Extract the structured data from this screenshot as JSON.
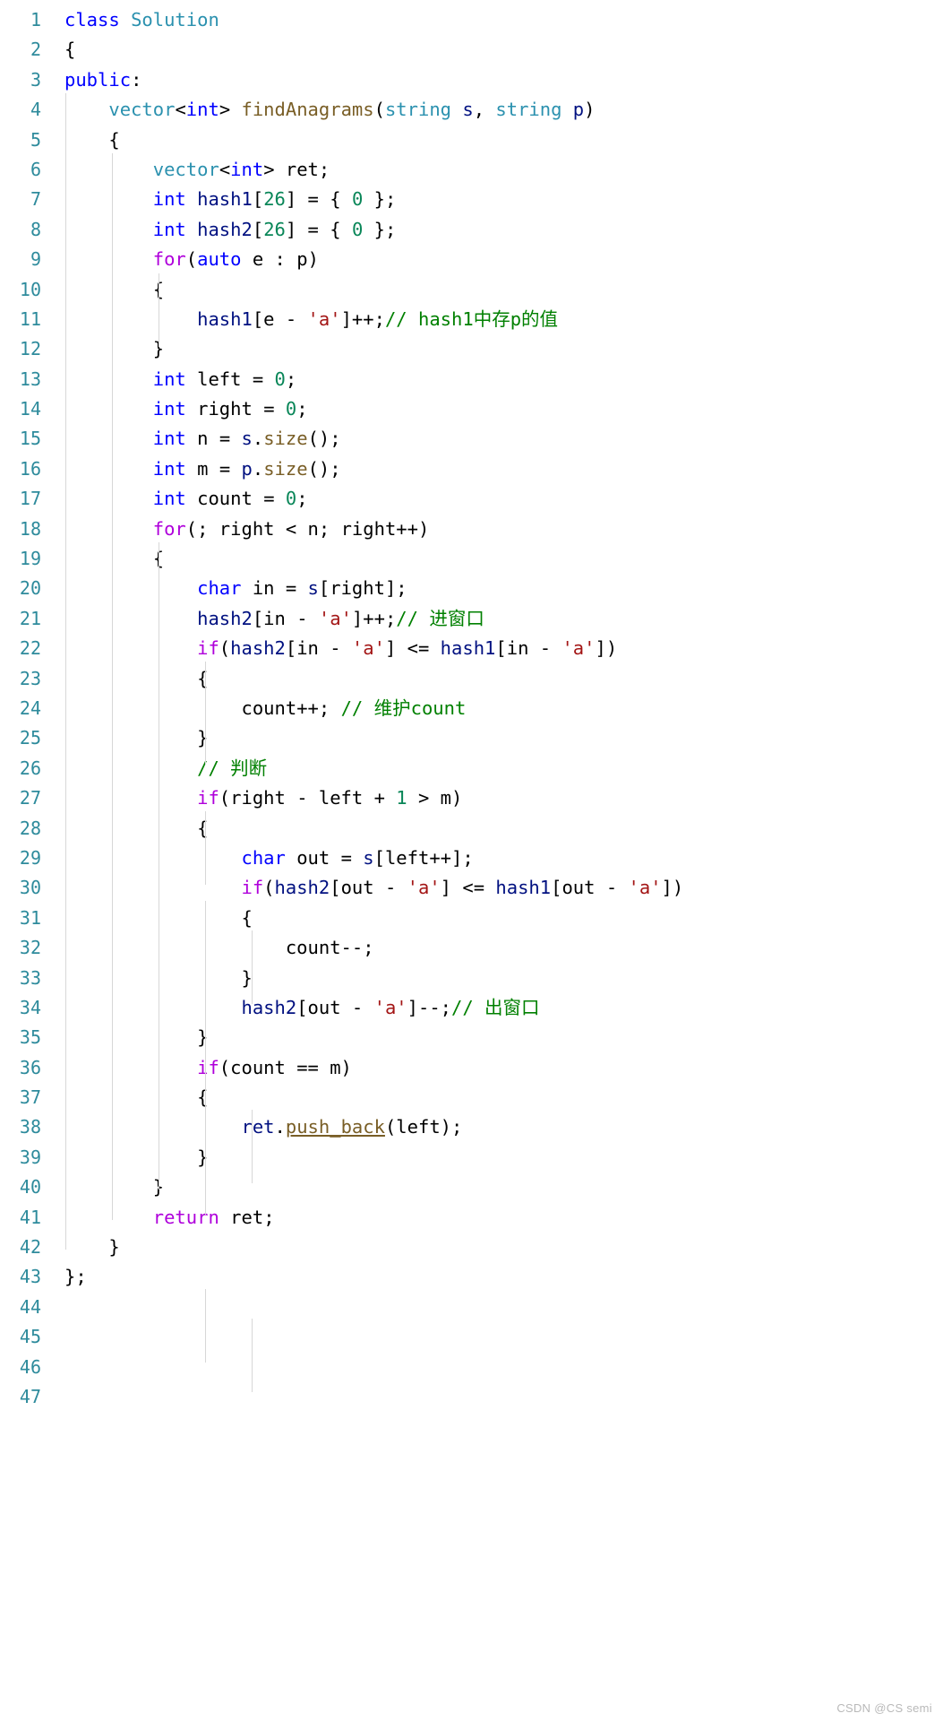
{
  "editor": {
    "language": "cpp",
    "first_line": 1,
    "last_line": 47,
    "colors": {
      "background": "#ffffff",
      "line_number": "#2e8b9c",
      "keyword": "#0000ff",
      "control_keyword": "#af00db",
      "type": "#2b91af",
      "function": "#795e26",
      "variable": "#001080",
      "number": "#098658",
      "string": "#a31515",
      "comment": "#008000",
      "indent_guide": "#d7d7d7",
      "watermark": "#b9b9b9"
    }
  },
  "line_numbers": [
    "1",
    "2",
    "3",
    "4",
    "5",
    "6",
    "7",
    "8",
    "9",
    "10",
    "11",
    "12",
    "13",
    "14",
    "15",
    "16",
    "17",
    "18",
    "19",
    "20",
    "21",
    "22",
    "23",
    "24",
    "25",
    "26",
    "27",
    "28",
    "29",
    "30",
    "31",
    "32",
    "33",
    "34",
    "35",
    "36",
    "37",
    "38",
    "39",
    "40",
    "41",
    "42",
    "43",
    "44",
    "45",
    "46",
    "47"
  ],
  "code_lines": [
    "class Solution",
    "{",
    "public:",
    "    vector<int> findAnagrams(string s, string p)",
    "    {",
    "        vector<int> ret;",
    "        int hash1[26] = { 0 };",
    "        int hash2[26] = { 0 };",
    "        for(auto e : p)",
    "        {",
    "            hash1[e - 'a']++;// hash1中存p的值",
    "        }",
    "        int left = 0;",
    "        int right = 0;",
    "        int n = s.size();",
    "        int m = p.size();",
    "        int count = 0;",
    "        for(; right < n; right++)",
    "        {",
    "            char in = s[right];",
    "            hash2[in - 'a']++;// 进窗口",
    "            if(hash2[in - 'a'] <= hash1[in - 'a'])",
    "            {",
    "                count++; // 维护count",
    "            }",
    "            // 判断",
    "            if(right - left + 1 > m)",
    "            {",
    "                char out = s[left++];",
    "                if(hash2[out - 'a'] <= hash1[out - 'a'])",
    "                {",
    "                    count--;",
    "                }",
    "                hash2[out - 'a']--;// 出窗口",
    "            }",
    "            if(count == m)",
    "            {",
    "                ret.push_back(left);",
    "            }",
    "        }",
    "        return ret;",
    "    }",
    "};",
    "",
    "",
    "",
    "",
    ""
  ],
  "comments": {
    "line_11": "// hash1中存p的值",
    "line_21": "// 进窗口",
    "line_24": "// 维护count",
    "line_26": "// 判断",
    "line_34": "// 出窗口"
  },
  "watermark": {
    "text": "CSDN @CS semi"
  }
}
